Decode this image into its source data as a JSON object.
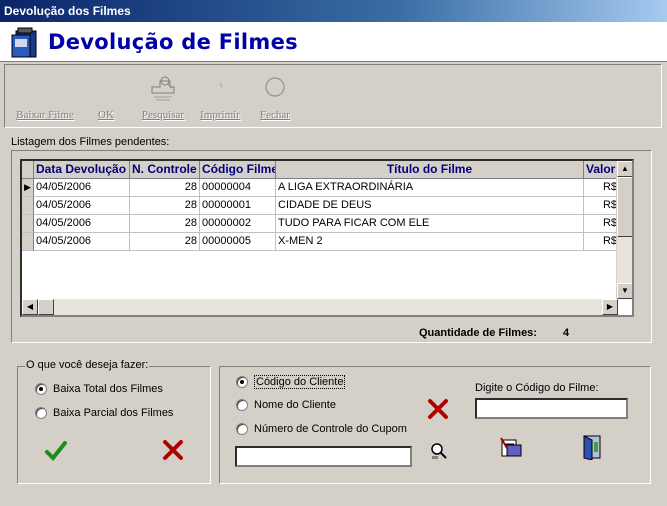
{
  "window": {
    "title": "Devolução dos Filmes"
  },
  "header": {
    "title": "Devolução de Filmes"
  },
  "toolbar": {
    "buttons": [
      {
        "label": "Baixar Filme",
        "icon": "none"
      },
      {
        "label": "OK",
        "icon": "none"
      },
      {
        "label": "Pesquisar",
        "icon": "search-icon"
      },
      {
        "label": "Imprimir",
        "icon": "printer-icon"
      },
      {
        "label": "Fechar",
        "icon": "close-icon"
      }
    ]
  },
  "listing": {
    "label": "Listagem dos Filmes pendentes:",
    "columns": [
      "Data Devolução",
      "N. Controle",
      "Código Filme",
      "Título do Filme",
      "Valor"
    ],
    "rows": [
      [
        "04/05/2006",
        "28",
        "00000004",
        "A LIGA EXTRAORDINÁRIA",
        "R$"
      ],
      [
        "04/05/2006",
        "28",
        "00000001",
        "CIDADE DE DEUS",
        "R$"
      ],
      [
        "04/05/2006",
        "28",
        "00000002",
        "TUDO PARA FICAR COM ELE",
        "R$"
      ],
      [
        "04/05/2006",
        "28",
        "00000005",
        "X-MEN 2",
        "R$"
      ]
    ],
    "quantity_label": "Quantidade de Filmes:",
    "quantity_value": "4"
  },
  "options": {
    "caption": "O que você deseja fazer:",
    "total": "Baixa Total dos Filmes",
    "partial": "Baixa Parcial dos Filmes",
    "selected": "total"
  },
  "search": {
    "by_code": "Código do Cliente",
    "by_name": "Nome do Cliente",
    "by_coupon": "Número de Controle do Cupom",
    "selected": "by_code",
    "search_value": "",
    "film_code_label": "Digite o Código do Filme:",
    "film_code_value": ""
  },
  "colors": {
    "title_start": "#0a246a",
    "title_end": "#a6caf0",
    "header_text": "#0000a8",
    "check": "#1c8c1c",
    "cross": "#b00000"
  }
}
